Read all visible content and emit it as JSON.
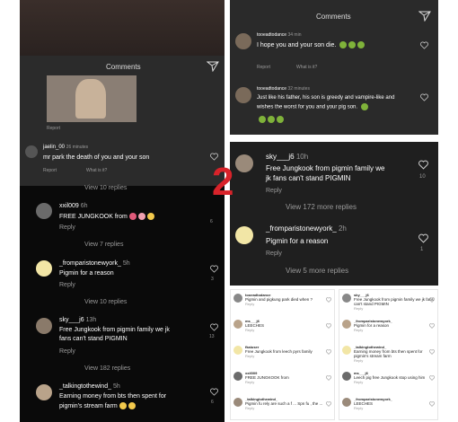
{
  "left": {
    "title": "Comments",
    "post_footer": "Report",
    "top_comment": {
      "user": "jaelin_00",
      "time": "26 minutes",
      "text": "mr park the death of you and your son",
      "report": "Report",
      "what": "What is it?"
    },
    "comments": [
      {
        "view": "View 10 replies",
        "user": "xxil009",
        "time": "6h",
        "text": "FREE JUNGKOOK from",
        "reply": "Reply",
        "likes": "6"
      },
      {
        "view": "View 7 replies",
        "user": "_fromparistonewyork_",
        "time": "5h",
        "text": "Pigmin for a reason",
        "reply": "Reply",
        "likes": "3"
      },
      {
        "view": "View 10 replies",
        "user": "sky___j6",
        "time": "13h",
        "text": "Free Jungkook from pigmin family we jk",
        "text2": "fans can't stand PIGMIN",
        "reply": "Reply",
        "likes": "13"
      },
      {
        "view": "View 182 replies",
        "user": "_talkingtothewind_",
        "time": "5h",
        "text": "Earning money from bts then spent for",
        "text2": "pigmin's stream farm",
        "reply": "",
        "likes": "6"
      }
    ]
  },
  "right_top": {
    "title": "Comments",
    "c1": {
      "user": "tooeadtodance",
      "time": "34 min",
      "text": "I hope you and your son die.",
      "report": "Report",
      "what": "What is it?"
    },
    "c2": {
      "user": "tooeadtodance",
      "time": "32 minutes",
      "text": "Just like his father, his son is greedy and vampire-like and",
      "text2": "wishes the worst for you and your pig son.",
      "report": "Report",
      "what": "What is it?"
    }
  },
  "right_mid": {
    "c1": {
      "user": "sky___j6",
      "time": "10h",
      "text": "Free Jungkook from pigmin family we",
      "text2": "jk fans can't stand PIGMIN",
      "reply": "Reply",
      "view": "View 172 more replies",
      "likes": "10"
    },
    "c2": {
      "user": "_fromparistonewyork_",
      "time": "2h",
      "text": "Pigmin for a reason",
      "reply": "Reply",
      "view": "View 5 more replies",
      "likes": "1"
    }
  },
  "badge": "2",
  "mini_left": [
    {
      "user": "tooeadtodance",
      "text": "Pigmin and pigkung park died when ?",
      "meta": "Reply"
    },
    {
      "user": "ms___j6",
      "text": "LEECHES",
      "meta": "Reply"
    },
    {
      "user": "fkaiuser",
      "text": "Free Jungkook from leech pyrs family",
      "meta": "Reply"
    },
    {
      "user": "xxil009",
      "text": "FREE JUNGKOOK from",
      "meta": "Reply"
    },
    {
      "user": "_talkingtothewind_",
      "text": "Pigmin fu rely are such a f ... Spn fu , the ...",
      "meta": "Reply"
    }
  ],
  "mini_right": [
    {
      "user": "sky___j6",
      "text": "Free Jungkook from pigmin family we jk fans can't stand PIGMIN",
      "meta": "Reply"
    },
    {
      "user": "_fromparistonewyork_",
      "text": "Pigmin for a reason",
      "meta": "Reply"
    },
    {
      "user": "_talkingtothewind_",
      "text": "Earning money from bts then spent for pigmin's stream farm",
      "meta": "Reply"
    },
    {
      "user": "ms___j6",
      "text": "Leech pig free Jungkook stop using him",
      "meta": "Reply"
    },
    {
      "user": "_fromparistonewyork_",
      "text": "LEECHES",
      "meta": "Reply"
    }
  ]
}
